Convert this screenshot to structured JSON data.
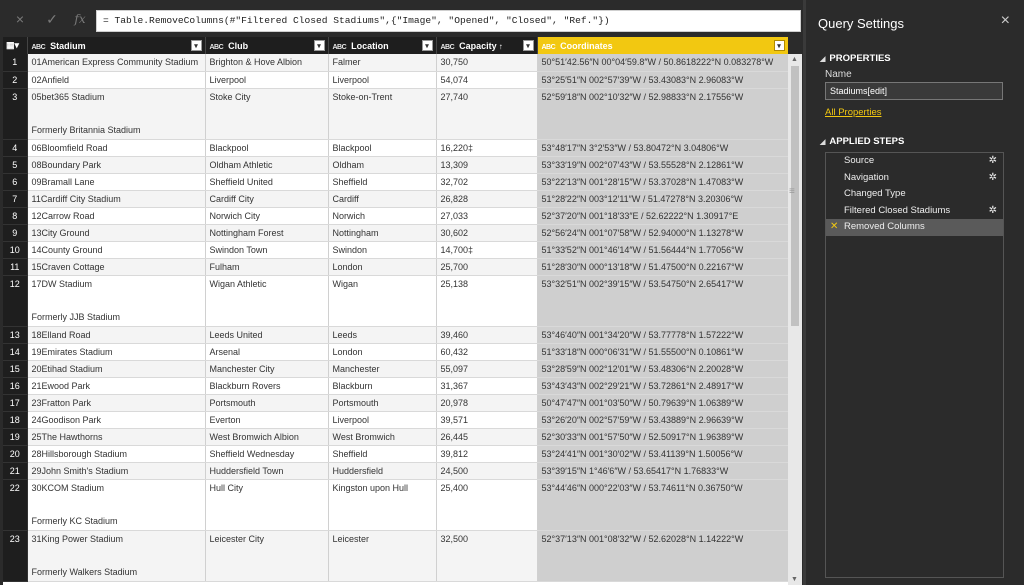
{
  "formula_bar": {
    "cancel_icon": "×",
    "commit_icon": "✓",
    "fx_label": "fx",
    "formula": "= Table.RemoveColumns(#\"Filtered Closed Stadiums\",{\"Image\", \"Opened\", \"Closed\", \"Ref.\"})"
  },
  "columns": [
    {
      "type": "ABC",
      "name": "Stadium"
    },
    {
      "type": "ABC",
      "name": "Club"
    },
    {
      "type": "ABC",
      "name": "Location"
    },
    {
      "type": "ABC",
      "name": "Capacity",
      "sort": "↑"
    },
    {
      "type": "ABC",
      "name": "Coordinates"
    }
  ],
  "rows": [
    {
      "n": "1",
      "stadium": "01American Express Community Stadium",
      "club": "Brighton & Hove Albion",
      "location": "Falmer",
      "capacity": "30,750",
      "coords": "50°51′42.56″N 00°04′59.8″W / 50.8618222°N 0.083278°W"
    },
    {
      "n": "2",
      "stadium": "02Anfield",
      "club": "Liverpool",
      "location": "Liverpool",
      "capacity": "54,074",
      "coords": "53°25′51″N 002°57′39″W / 53.43083°N 2.96083°W"
    },
    {
      "n": "3",
      "stadium": "05bet365 Stadium",
      "former": "Formerly Britannia Stadium",
      "club": "Stoke City",
      "location": "Stoke-on-Trent",
      "capacity": "27,740",
      "coords": "52°59′18″N 002°10′32″W / 52.98833°N 2.17556°W"
    },
    {
      "n": "4",
      "stadium": "06Bloomfield Road",
      "club": "Blackpool",
      "location": "Blackpool",
      "capacity": "16,220‡",
      "coords": "53°48′17″N 3°2′53″W / 53.80472°N 3.04806°W"
    },
    {
      "n": "5",
      "stadium": "08Boundary Park",
      "club": "Oldham Athletic",
      "location": "Oldham",
      "capacity": "13,309",
      "coords": "53°33′19″N 002°07′43″W / 53.55528°N 2.12861°W"
    },
    {
      "n": "6",
      "stadium": "09Bramall Lane",
      "club": "Sheffield United",
      "location": "Sheffield",
      "capacity": "32,702",
      "coords": "53°22′13″N 001°28′15″W / 53.37028°N 1.47083°W"
    },
    {
      "n": "7",
      "stadium": "11Cardiff City Stadium",
      "club": "Cardiff City",
      "location": "Cardiff",
      "capacity": "26,828",
      "coords": "51°28′22″N 003°12′11″W / 51.47278°N 3.20306°W"
    },
    {
      "n": "8",
      "stadium": "12Carrow Road",
      "club": "Norwich City",
      "location": "Norwich",
      "capacity": "27,033",
      "coords": "52°37′20″N 001°18′33″E / 52.62222°N 1.30917°E"
    },
    {
      "n": "9",
      "stadium": "13City Ground",
      "club": "Nottingham Forest",
      "location": "Nottingham",
      "capacity": "30,602",
      "coords": "52°56′24″N 001°07′58″W / 52.94000°N 1.13278°W"
    },
    {
      "n": "10",
      "stadium": "14County Ground",
      "club": "Swindon Town",
      "location": "Swindon",
      "capacity": "14,700‡",
      "coords": "51°33′52″N 001°46′14″W / 51.56444°N 1.77056°W"
    },
    {
      "n": "11",
      "stadium": "15Craven Cottage",
      "club": "Fulham",
      "location": "London",
      "capacity": "25,700",
      "coords": "51°28′30″N 000°13′18″W / 51.47500°N 0.22167°W"
    },
    {
      "n": "12",
      "stadium": "17DW Stadium",
      "former": "Formerly JJB Stadium",
      "club": "Wigan Athletic",
      "location": "Wigan",
      "capacity": "25,138",
      "coords": "53°32′51″N 002°39′15″W / 53.54750°N 2.65417°W"
    },
    {
      "n": "13",
      "stadium": "18Elland Road",
      "club": "Leeds United",
      "location": "Leeds",
      "capacity": "39,460",
      "coords": "53°46′40″N 001°34′20″W / 53.77778°N 1.57222°W"
    },
    {
      "n": "14",
      "stadium": "19Emirates Stadium",
      "club": "Arsenal",
      "location": "London",
      "capacity": "60,432",
      "coords": "51°33′18″N 000°06′31″W / 51.55500°N 0.10861°W"
    },
    {
      "n": "15",
      "stadium": "20Etihad Stadium",
      "club": "Manchester City",
      "location": "Manchester",
      "capacity": "55,097",
      "coords": "53°28′59″N 002°12′01″W / 53.48306°N 2.20028°W"
    },
    {
      "n": "16",
      "stadium": "21Ewood Park",
      "club": "Blackburn Rovers",
      "location": "Blackburn",
      "capacity": "31,367",
      "coords": "53°43′43″N 002°29′21″W / 53.72861°N 2.48917°W"
    },
    {
      "n": "17",
      "stadium": "23Fratton Park",
      "club": "Portsmouth",
      "location": "Portsmouth",
      "capacity": "20,978",
      "coords": "50°47′47″N 001°03′50″W / 50.79639°N 1.06389°W"
    },
    {
      "n": "18",
      "stadium": "24Goodison Park",
      "club": "Everton",
      "location": "Liverpool",
      "capacity": "39,571",
      "coords": "53°26′20″N 002°57′59″W / 53.43889°N 2.96639°W"
    },
    {
      "n": "19",
      "stadium": "25The Hawthorns",
      "club": "West Bromwich Albion",
      "location": "West Bromwich",
      "capacity": "26,445",
      "coords": "52°30′33″N 001°57′50″W / 52.50917°N 1.96389°W"
    },
    {
      "n": "20",
      "stadium": "28Hillsborough Stadium",
      "club": "Sheffield Wednesday",
      "location": "Sheffield",
      "capacity": "39,812",
      "coords": "53°24′41″N 001°30′02″W / 53.41139°N 1.50056°W"
    },
    {
      "n": "21",
      "stadium": "29John Smith's Stadium",
      "club": "Huddersfield Town",
      "location": "Huddersfield",
      "capacity": "24,500",
      "coords": "53°39′15″N 1°46′6″W / 53.65417°N 1.76833°W"
    },
    {
      "n": "22",
      "stadium": "30KCOM Stadium",
      "former": "Formerly KC Stadium",
      "club": "Hull City",
      "location": "Kingston upon Hull",
      "capacity": "25,400",
      "coords": "53°44′46″N 000°22′03″W / 53.74611°N 0.36750°W"
    },
    {
      "n": "23",
      "stadium": "31King Power Stadium",
      "former": "Formerly Walkers Stadium",
      "club": "Leicester City",
      "location": "Leicester",
      "capacity": "32,500",
      "coords": "52°37′13″N 001°08′32″W / 52.62028°N 1.14222°W"
    }
  ],
  "query_settings": {
    "title": "Query Settings",
    "close_icon": "×",
    "properties_title": "PROPERTIES",
    "name_label": "Name",
    "name_value": "Stadiums[edit]",
    "all_properties": "All Properties",
    "applied_steps_title": "APPLIED STEPS",
    "steps": [
      {
        "label": "Source",
        "gear": true
      },
      {
        "label": "Navigation",
        "gear": true
      },
      {
        "label": "Changed Type",
        "gear": false
      },
      {
        "label": "Filtered Closed Stadiums",
        "gear": true
      },
      {
        "label": "Removed Columns",
        "gear": false,
        "selected": true
      }
    ]
  },
  "colors": {
    "accent": "#f2c811",
    "pane_bg": "#2b2b2b",
    "selected_step": "#5a5a5a"
  }
}
